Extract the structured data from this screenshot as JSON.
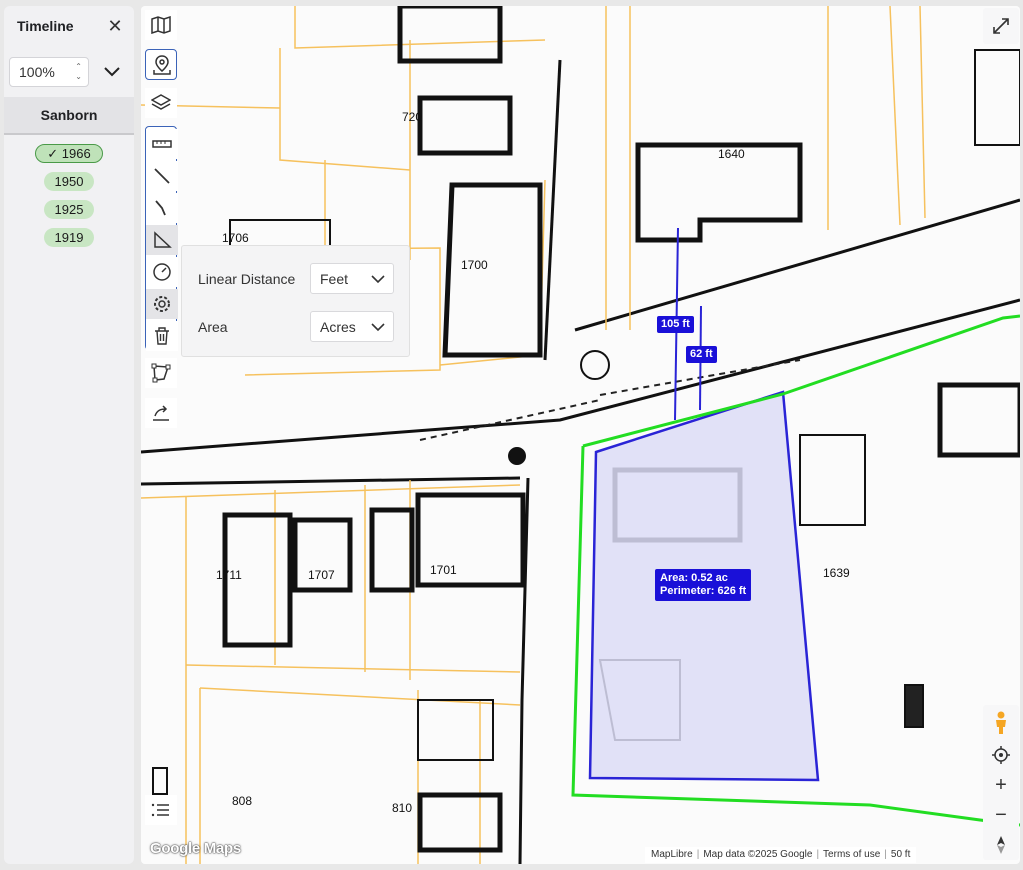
{
  "timeline": {
    "title": "Timeline",
    "zoom_value": "100%",
    "source": "Sanborn",
    "years": [
      "1966",
      "1950",
      "1925",
      "1919"
    ],
    "active_year": "1966"
  },
  "settings": {
    "linear_label": "Linear Distance",
    "linear_value": "Feet",
    "area_label": "Area",
    "area_value": "Acres"
  },
  "measurements": {
    "dist1": "105 ft",
    "dist2": "62 ft",
    "area": "Area: 0.52 ac",
    "perimeter": "Perimeter: 626 ft"
  },
  "lot_numbers": [
    "720",
    "1640",
    "1706",
    "1700",
    "1711",
    "1707",
    "1701",
    "1639",
    "808",
    "810"
  ],
  "attribution": {
    "maplibre": "MapLibre",
    "mapdata": "Map data ©2025 Google",
    "terms": "Terms of use",
    "scale": "50 ft"
  },
  "brand": "Google Maps",
  "colors": {
    "parcel_outline": "#22dd22",
    "measure_line": "#2a24d6",
    "measure_fill": "#dcdcf6",
    "lot_lines": "#f6c15d",
    "badge": "#1a10d8"
  }
}
